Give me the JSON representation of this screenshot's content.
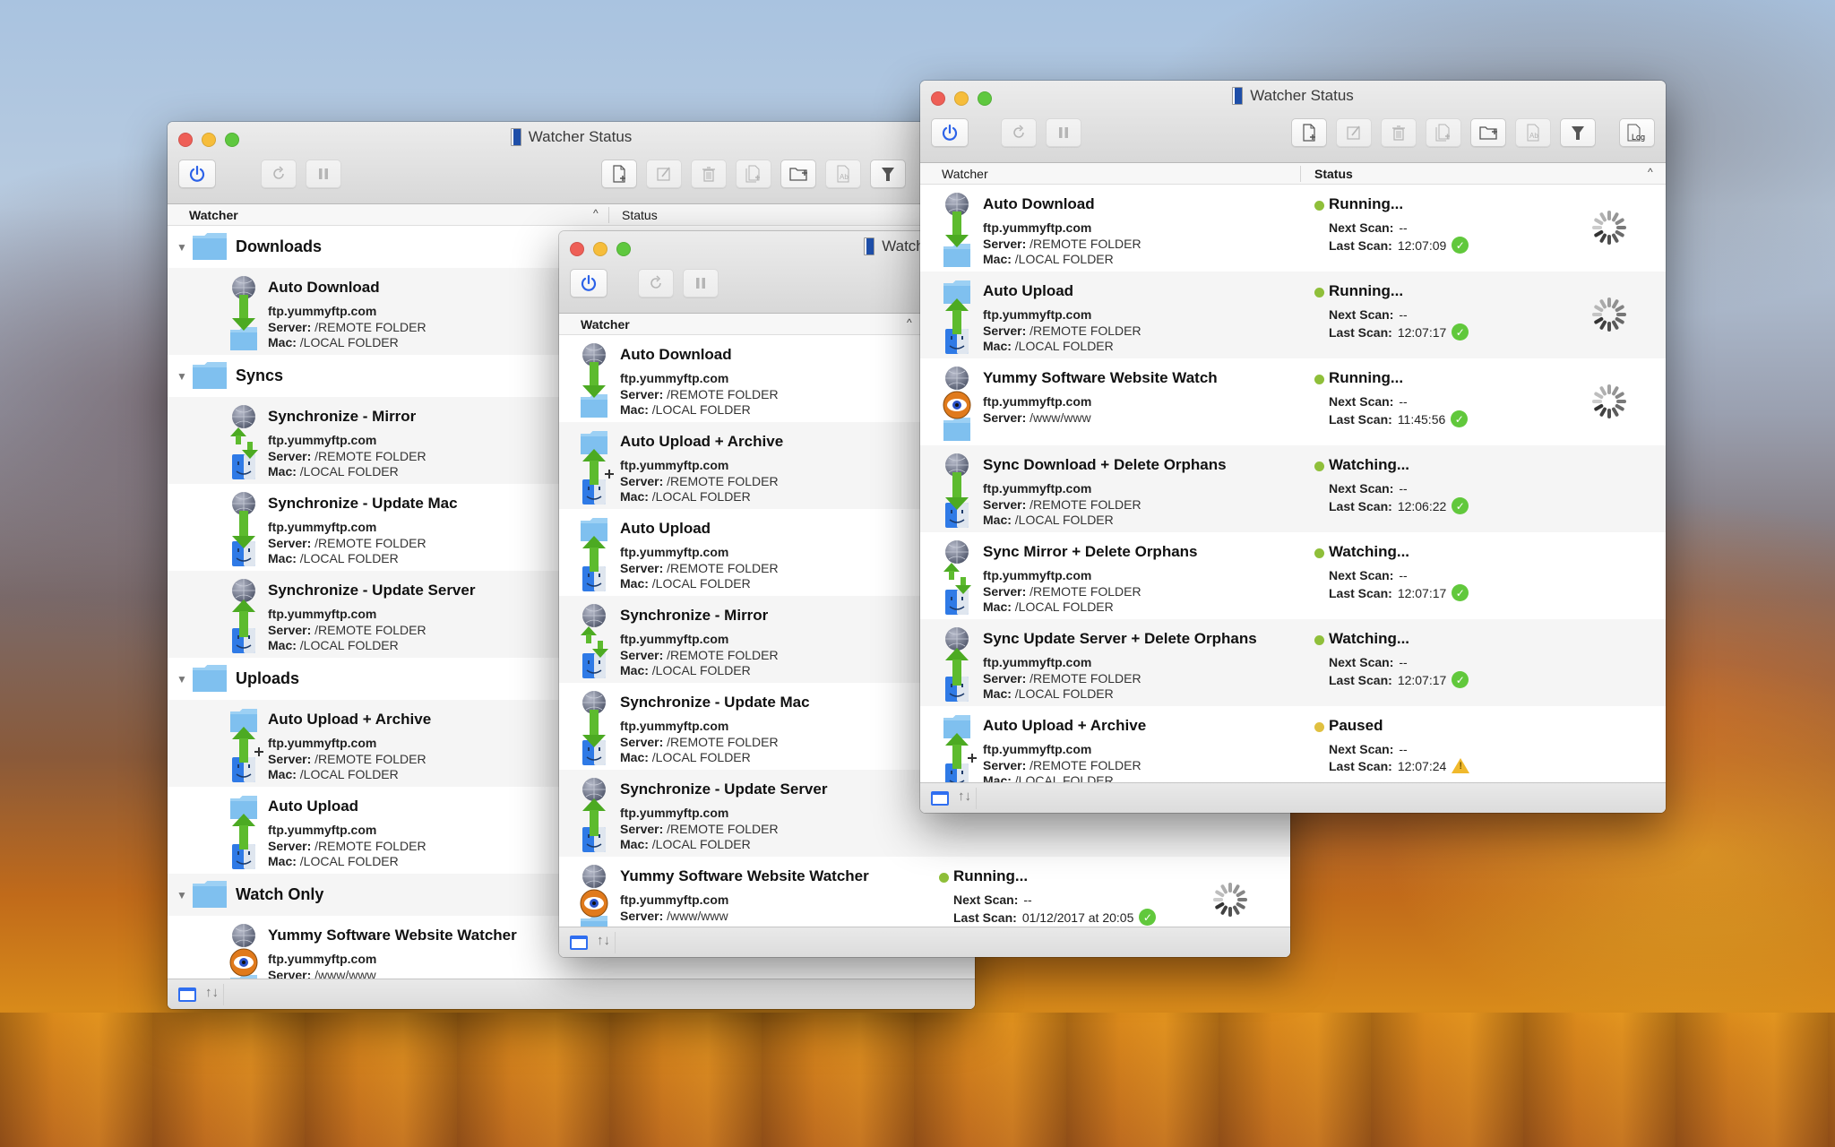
{
  "windows": {
    "left": {
      "title": "Watcher Status",
      "columns": {
        "watcher": "Watcher",
        "status": "Status"
      },
      "groups": [
        {
          "label": "Downloads",
          "items": [
            {
              "name": "Auto Download",
              "host": "ftp.yummyftp.com",
              "server": "/REMOTE FOLDER",
              "mac": "/LOCAL FOLDER",
              "icon": "download"
            }
          ]
        },
        {
          "label": "Syncs",
          "items": [
            {
              "name": "Synchronize - Mirror",
              "host": "ftp.yummyftp.com",
              "server": "/REMOTE FOLDER",
              "mac": "/LOCAL FOLDER",
              "icon": "mirror"
            },
            {
              "name": "Synchronize - Update Mac",
              "host": "ftp.yummyftp.com",
              "server": "/REMOTE FOLDER",
              "mac": "/LOCAL FOLDER",
              "icon": "sync-down"
            },
            {
              "name": "Synchronize - Update Server",
              "host": "ftp.yummyftp.com",
              "server": "/REMOTE FOLDER",
              "mac": "/LOCAL FOLDER",
              "icon": "sync-up"
            }
          ]
        },
        {
          "label": "Uploads",
          "items": [
            {
              "name": "Auto Upload + Archive",
              "host": "ftp.yummyftp.com",
              "server": "/REMOTE FOLDER",
              "mac": "/LOCAL FOLDER",
              "icon": "upload-archive"
            },
            {
              "name": "Auto Upload",
              "host": "ftp.yummyftp.com",
              "server": "/REMOTE FOLDER",
              "mac": "/LOCAL FOLDER",
              "icon": "upload"
            }
          ]
        },
        {
          "label": "Watch Only",
          "items": [
            {
              "name": "Yummy Software Website Watcher",
              "host": "ftp.yummyftp.com",
              "server": "/www/www",
              "mac": null,
              "icon": "watch"
            }
          ]
        }
      ]
    },
    "middle": {
      "title": "Watcher Status",
      "columns": {
        "watcher": "Watcher"
      },
      "items": [
        {
          "name": "Auto Download",
          "host": "ftp.yummyftp.com",
          "server": "/REMOTE FOLDER",
          "mac": "/LOCAL FOLDER",
          "icon": "download"
        },
        {
          "name": "Auto Upload + Archive",
          "host": "ftp.yummyftp.com",
          "server": "/REMOTE FOLDER",
          "mac": "/LOCAL FOLDER",
          "icon": "upload-archive"
        },
        {
          "name": "Auto Upload",
          "host": "ftp.yummyftp.com",
          "server": "/REMOTE FOLDER",
          "mac": "/LOCAL FOLDER",
          "icon": "upload"
        },
        {
          "name": "Synchronize - Mirror",
          "host": "ftp.yummyftp.com",
          "server": "/REMOTE FOLDER",
          "mac": "/LOCAL FOLDER",
          "icon": "mirror"
        },
        {
          "name": "Synchronize - Update Mac",
          "host": "ftp.yummyftp.com",
          "server": "/REMOTE FOLDER",
          "mac": "/LOCAL FOLDER",
          "icon": "sync-down"
        },
        {
          "name": "Synchronize - Update Server",
          "host": "ftp.yummyftp.com",
          "server": "/REMOTE FOLDER",
          "mac": "/LOCAL FOLDER",
          "icon": "sync-up"
        },
        {
          "name": "Yummy Software Website Watcher",
          "host": "ftp.yummyftp.com",
          "server": "/www/www",
          "mac": null,
          "icon": "watch",
          "status": "Running...",
          "status_color": "#8fbf3a",
          "next_scan": "--",
          "last_scan": "01/12/2017 at 20:05",
          "result": "ok",
          "spinner": true
        }
      ]
    },
    "right": {
      "title": "Watcher Status",
      "columns": {
        "watcher": "Watcher",
        "status": "Status"
      },
      "items": [
        {
          "name": "Auto Download",
          "host": "ftp.yummyftp.com",
          "server": "/REMOTE FOLDER",
          "mac": "/LOCAL FOLDER",
          "icon": "download",
          "status": "Running...",
          "status_color": "#8fbf3a",
          "next_scan": "--",
          "last_scan": "12:07:09",
          "result": "ok",
          "spinner": true
        },
        {
          "name": "Auto Upload",
          "host": "ftp.yummyftp.com",
          "server": "/REMOTE FOLDER",
          "mac": "/LOCAL FOLDER",
          "icon": "upload",
          "status": "Running...",
          "status_color": "#8fbf3a",
          "next_scan": "--",
          "last_scan": "12:07:17",
          "result": "ok",
          "spinner": true
        },
        {
          "name": "Yummy Software Website Watch",
          "host": "ftp.yummyftp.com",
          "server": "/www/www",
          "mac": null,
          "icon": "watch",
          "status": "Running...",
          "status_color": "#8fbf3a",
          "next_scan": "--",
          "last_scan": "11:45:56",
          "result": "ok",
          "spinner": true
        },
        {
          "name": "Sync Download + Delete Orphans",
          "host": "ftp.yummyftp.com",
          "server": "/REMOTE FOLDER",
          "mac": "/LOCAL FOLDER",
          "icon": "sync-down",
          "status": "Watching...",
          "status_color": "#8fbf3a",
          "next_scan": "--",
          "last_scan": "12:06:22",
          "result": "ok",
          "spinner": false
        },
        {
          "name": "Sync Mirror + Delete Orphans",
          "host": "ftp.yummyftp.com",
          "server": "/REMOTE FOLDER",
          "mac": "/LOCAL FOLDER",
          "icon": "mirror",
          "status": "Watching...",
          "status_color": "#8fbf3a",
          "next_scan": "--",
          "last_scan": "12:07:17",
          "result": "ok",
          "spinner": false
        },
        {
          "name": "Sync Update Server + Delete Orphans",
          "host": "ftp.yummyftp.com",
          "server": "/REMOTE FOLDER",
          "mac": "/LOCAL FOLDER",
          "icon": "sync-up",
          "status": "Watching...",
          "status_color": "#8fbf3a",
          "next_scan": "--",
          "last_scan": "12:07:17",
          "result": "ok",
          "spinner": false
        },
        {
          "name": "Auto Upload + Archive",
          "host": "ftp.yummyftp.com",
          "server": "/REMOTE FOLDER",
          "mac": "/LOCAL FOLDER",
          "icon": "upload-archive",
          "status": "Paused",
          "status_color": "#e0c040",
          "next_scan": "--",
          "last_scan": "12:07:24",
          "result": "warning",
          "spinner": false
        }
      ]
    }
  },
  "labels": {
    "server": "Server:",
    "mac": "Mac:",
    "next_scan": "Next Scan:",
    "last_scan": "Last Scan:"
  },
  "toolbar": {
    "buttons": [
      "power",
      "refresh",
      "pause",
      "new-watcher",
      "edit",
      "delete",
      "duplicate",
      "new-group",
      "rename",
      "filter",
      "log"
    ],
    "log_label": "Log"
  },
  "colors": {
    "accent": "#2c62e8",
    "ok": "#61c83c",
    "running": "#8fbf3a",
    "paused": "#e0c040",
    "warning": "#f0b92c"
  }
}
